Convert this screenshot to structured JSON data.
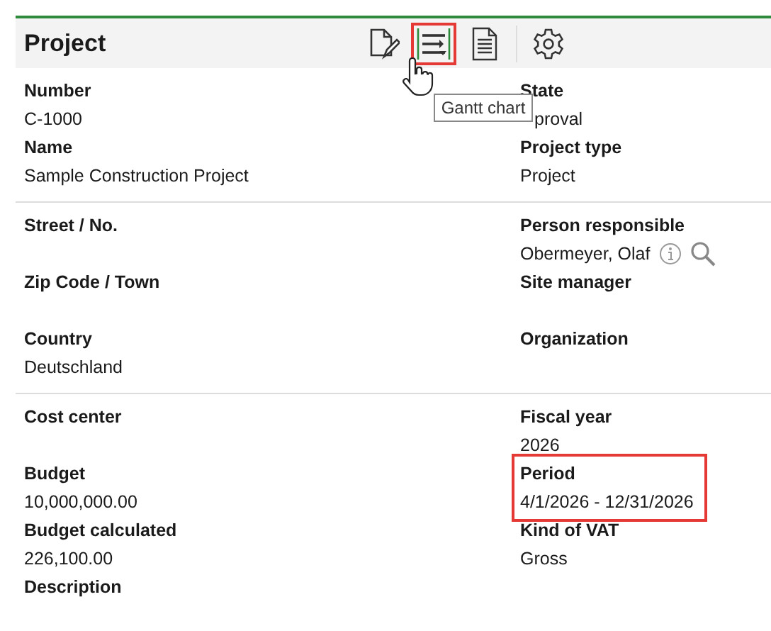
{
  "header": {
    "title": "Project",
    "toolbar": [
      {
        "kind": "edit",
        "highlighted": false
      },
      {
        "kind": "gantt",
        "highlighted": true
      },
      {
        "kind": "report",
        "highlighted": false
      },
      {
        "kind": "settings",
        "highlighted": false
      }
    ],
    "tooltip": "Gantt chart"
  },
  "sections": [
    {
      "left": [
        {
          "label": "Number",
          "value": "C-1000"
        },
        {
          "label": "Name",
          "value": "Sample Construction Project"
        }
      ],
      "right": [
        {
          "label": "State",
          "value": "proval"
        },
        {
          "label": "Project type",
          "value": "Project"
        }
      ]
    },
    {
      "left": [
        {
          "label": "Street / No."
        },
        {
          "label": "Zip Code / Town"
        },
        {
          "label": "Country",
          "value": "Deutschland"
        }
      ],
      "right": [
        {
          "label": "Person responsible",
          "value": "Obermeyer, Olaf",
          "info": true,
          "search": true
        },
        {
          "label": "Site manager"
        },
        {
          "label": "Organization"
        }
      ]
    },
    {
      "left": [
        {
          "label": "Cost center"
        },
        {
          "label": "Budget",
          "value": "10,000,000.00"
        },
        {
          "label": "Budget calculated",
          "value": "226,100.00"
        },
        {
          "label": "Description"
        }
      ],
      "right": [
        {
          "label": "Fiscal year",
          "value": "2026"
        },
        {
          "label": "Period",
          "value": "4/1/2026 - 12/31/2026",
          "highlighted": true
        },
        {
          "label": "Kind of VAT",
          "value": "Gross"
        }
      ]
    }
  ]
}
